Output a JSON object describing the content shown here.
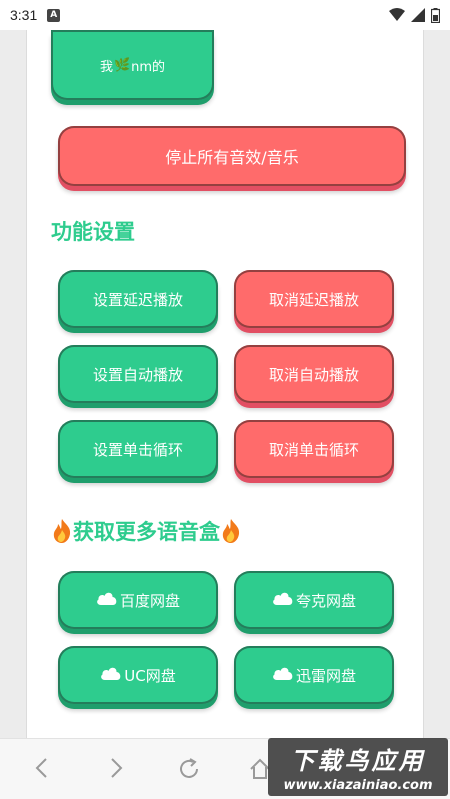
{
  "status_bar": {
    "time": "3:31",
    "notification_letter": "A"
  },
  "top_button": {
    "label_prefix": "我",
    "leaf_glyph": "🌿",
    "label_suffix": "nm的"
  },
  "stop_button": {
    "label": "停止所有音效/音乐"
  },
  "settings_section": {
    "title": "功能设置",
    "buttons": [
      {
        "label": "设置延迟播放",
        "color": "green"
      },
      {
        "label": "取消延迟播放",
        "color": "red"
      },
      {
        "label": "设置自动播放",
        "color": "green"
      },
      {
        "label": "取消自动播放",
        "color": "red"
      },
      {
        "label": "设置单击循环",
        "color": "green"
      },
      {
        "label": "取消单击循环",
        "color": "red"
      }
    ]
  },
  "more_section": {
    "title": "获取更多语音盒",
    "links": [
      {
        "label": "百度网盘"
      },
      {
        "label": "夸克网盘"
      },
      {
        "label": "UC网盘"
      },
      {
        "label": "迅雷网盘"
      }
    ]
  },
  "watermark": {
    "main": "下载鸟应用",
    "sub": "www.xiazainiao.com"
  },
  "colors": {
    "accent_green": "#2ecc8e",
    "accent_red": "#ff6b6b",
    "green_shadow": "#1f9e6c",
    "red_shadow": "#e24f63"
  }
}
